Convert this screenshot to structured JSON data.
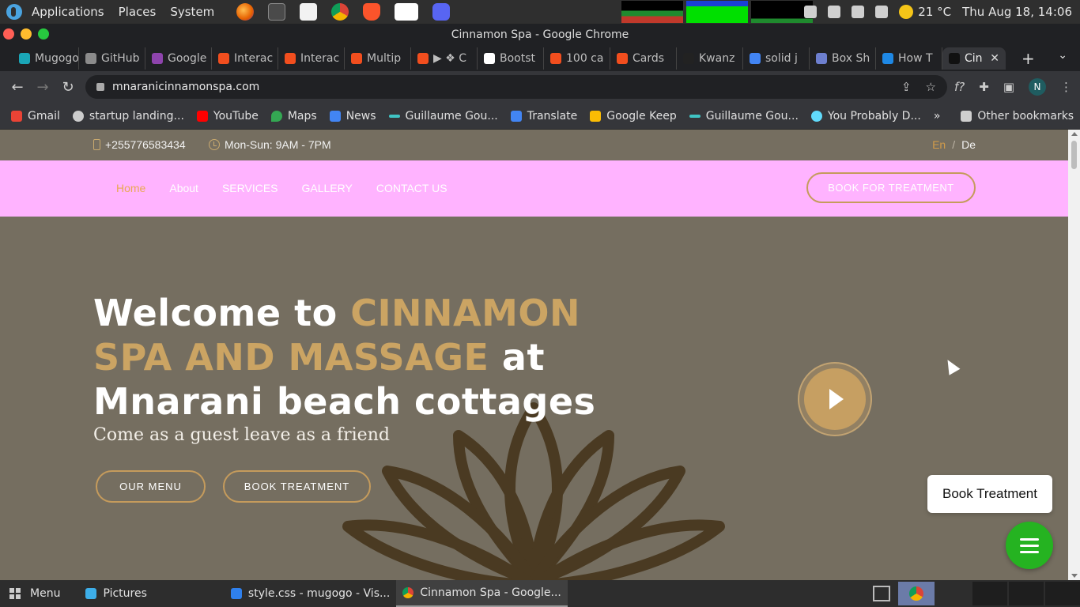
{
  "os": {
    "menu": [
      "Applications",
      "Places",
      "System"
    ],
    "temperature": "21 °C",
    "datetime": "Thu Aug 18, 14:06"
  },
  "window": {
    "title": "Cinnamon Spa - Google Chrome"
  },
  "tabs": [
    {
      "label": "Mugogo",
      "color": "#1aa6b7"
    },
    {
      "label": "GitHub",
      "color": "#8b8b8b"
    },
    {
      "label": "Google",
      "color": "#8e44ad"
    },
    {
      "label": "Interac",
      "color": "#f24e1e"
    },
    {
      "label": "Interac",
      "color": "#f24e1e"
    },
    {
      "label": "Multip",
      "color": "#f24e1e"
    },
    {
      "label": "▶ ❖ C",
      "color": "#f24e1e"
    },
    {
      "label": "Bootst",
      "color": "#ffffff"
    },
    {
      "label": "100 ca",
      "color": "#f24e1e"
    },
    {
      "label": "Cards",
      "color": "#f24e1e"
    },
    {
      "label": "Kwanz",
      "color": "#222222"
    },
    {
      "label": "solid j",
      "color": "#4285f4"
    },
    {
      "label": "Box Sh",
      "color": "#6d7fcf"
    },
    {
      "label": "How T",
      "color": "#1e88e5"
    }
  ],
  "active_tab": {
    "label": "Cin",
    "close": "✕"
  },
  "url": "mnaranicinnamonspa.com",
  "bookmarks": [
    {
      "label": "Gmail",
      "color": "#ea4335"
    },
    {
      "label": "startup landing...",
      "color": "#cccccc"
    },
    {
      "label": "YouTube",
      "color": "#ff0000"
    },
    {
      "label": "Maps",
      "color": "#34a853"
    },
    {
      "label": "News",
      "color": "#4285f4"
    },
    {
      "label": "Guillaume Gou...",
      "color": "#40c4c4"
    },
    {
      "label": "Translate",
      "color": "#4285f4"
    },
    {
      "label": "Google Keep",
      "color": "#fbbc04"
    },
    {
      "label": "Guillaume Gou...",
      "color": "#40c4c4"
    },
    {
      "label": "You Probably D...",
      "color": "#61dafb"
    }
  ],
  "bookmarks_more": "»",
  "other_bookmarks": "Other bookmarks",
  "avatar_initial": "N",
  "site": {
    "phone": "+255776583434",
    "hours": "Mon-Sun: 9AM - 7PM",
    "lang": {
      "en": "En",
      "sep": "/",
      "de": "De"
    },
    "nav": [
      "Home",
      "About",
      "SERVICES",
      "GALLERY",
      "CONTACT US"
    ],
    "nav_active": "Home",
    "book_cta": "BOOK FOR TREATMENT",
    "hero": {
      "title_1": "Welcome to ",
      "title_accent": "CINNAMON SPA AND MASSAGE",
      "title_2": " at Mnarani beach cottages",
      "tagline": "Come as a guest leave as a friend",
      "btn_menu": "OUR MENU",
      "btn_treatment": "BOOK TREATMENT"
    },
    "float_book": "Book Treatment"
  },
  "colors": {
    "accent": "#cba463",
    "nav_bg": "#ffb3ff",
    "hero_bg": "#756e60",
    "chat": "#25b321"
  },
  "taskbar": {
    "menu": "Menu",
    "items": [
      {
        "label": "Pictures",
        "color": "#3daee9"
      },
      {
        "label": "style.css - mugogo - Vis...",
        "color": "#2f80ed"
      },
      {
        "label": "Cinnamon Spa - Google...",
        "color": "#db4437"
      }
    ]
  }
}
